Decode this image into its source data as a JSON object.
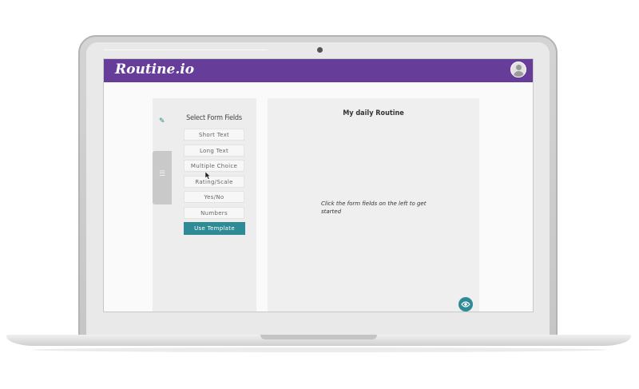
{
  "app": {
    "brand": "Routine.io",
    "avatar_icon": "user-avatar-icon",
    "accent_color": "#663d99",
    "button_color": "#2e8b95"
  },
  "rail": {
    "edit_icon": "pencil-icon",
    "list_icon": "list-icon"
  },
  "fields_panel": {
    "title": "Select Form Fields",
    "fields": [
      {
        "label": "Short Text"
      },
      {
        "label": "Long Text"
      },
      {
        "label": "Multiple Choice"
      },
      {
        "label": "Rating/Scale"
      },
      {
        "label": "Yes/No"
      },
      {
        "label": "Numbers"
      }
    ],
    "template_button": "Use Template"
  },
  "canvas": {
    "title": "My daily Routine",
    "empty_hint": "Click the form fields on the left to get started",
    "preview_icon": "eye-icon"
  }
}
